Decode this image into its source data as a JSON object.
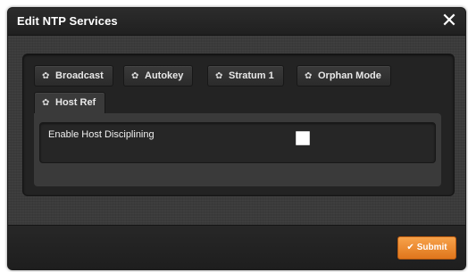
{
  "dialog": {
    "title": "Edit NTP Services",
    "close_glyph": "✕"
  },
  "tabs": [
    {
      "label": "Broadcast",
      "icon": "gear-icon",
      "active": false
    },
    {
      "label": "Autokey",
      "icon": "gear-icon",
      "active": false
    },
    {
      "label": "Stratum 1",
      "icon": "gear-icon",
      "active": false
    },
    {
      "label": "Orphan Mode",
      "icon": "gear-icon",
      "active": false
    },
    {
      "label": "Host Ref",
      "icon": "gear-icon",
      "active": true
    }
  ],
  "icons": {
    "gear_glyph": "✿"
  },
  "host_ref": {
    "enable_label": "Enable Host Disciplining",
    "enable_checked": false
  },
  "footer": {
    "submit_label": "Submit",
    "submit_glyph": "✔"
  },
  "colors": {
    "accent": "#f08c2e",
    "dialog_bg": "#2a2a2a"
  }
}
